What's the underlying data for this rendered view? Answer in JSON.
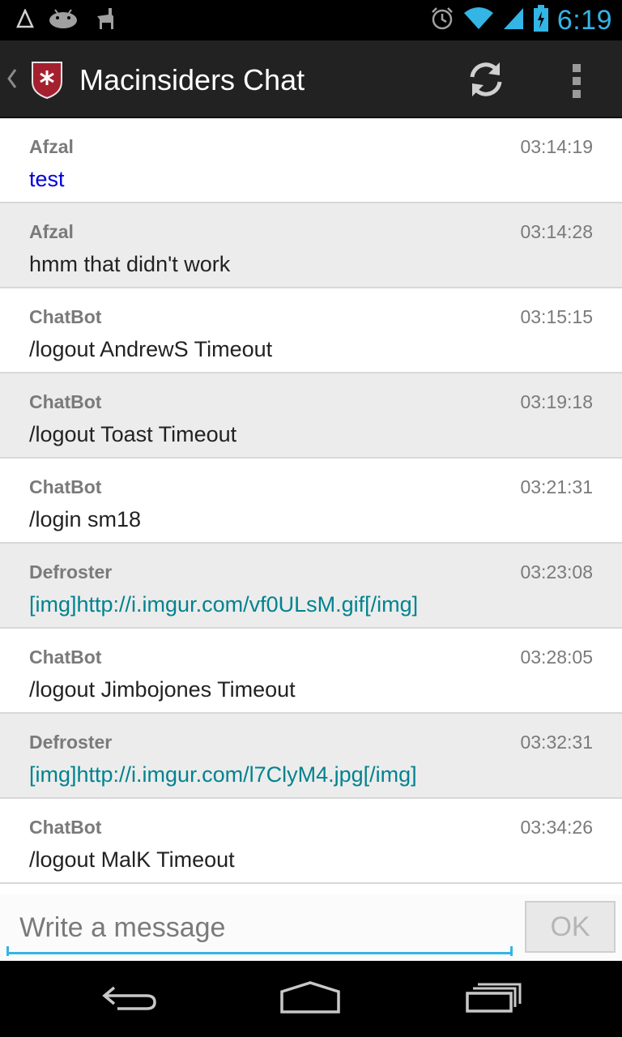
{
  "status_bar": {
    "time": "6:19",
    "left_icons": [
      "delta-icon",
      "android-icon",
      "llama-icon"
    ],
    "right_icons": [
      "alarm-icon",
      "wifi-icon",
      "signal-icon",
      "battery-charging-icon"
    ]
  },
  "action_bar": {
    "title": "Macinsiders Chat",
    "icons": [
      "up-chevron-icon",
      "app-logo-icon",
      "refresh-icon",
      "overflow-menu-icon"
    ]
  },
  "colors": {
    "accent": "#33b5e5",
    "link_blue": "#0000dd",
    "link_teal": "#00838f",
    "row_alt": "#ececec"
  },
  "messages": [
    {
      "author": "Afzal",
      "time": "03:14:19",
      "text": "test",
      "style": "blue"
    },
    {
      "author": "Afzal",
      "time": "03:14:28",
      "text": "hmm that didn't work",
      "style": "normal"
    },
    {
      "author": "ChatBot",
      "time": "03:15:15",
      "text": "/logout AndrewS Timeout",
      "style": "normal"
    },
    {
      "author": "ChatBot",
      "time": "03:19:18",
      "text": "/logout Toast Timeout",
      "style": "normal"
    },
    {
      "author": "ChatBot",
      "time": "03:21:31",
      "text": "/login sm18",
      "style": "normal"
    },
    {
      "author": "Defroster",
      "time": "03:23:08",
      "text": "[img]http://i.imgur.com/vf0ULsM.gif[/img]",
      "style": "link"
    },
    {
      "author": "ChatBot",
      "time": "03:28:05",
      "text": "/logout Jimbojones Timeout",
      "style": "normal"
    },
    {
      "author": "Defroster",
      "time": "03:32:31",
      "text": "[img]http://i.imgur.com/l7ClyM4.jpg[/img]",
      "style": "link"
    },
    {
      "author": "ChatBot",
      "time": "03:34:26",
      "text": "/logout MalK Timeout",
      "style": "normal"
    }
  ],
  "compose": {
    "placeholder": "Write a message",
    "value": "",
    "send_label": "OK"
  },
  "nav_bar": {
    "icons": [
      "back-icon",
      "home-icon",
      "recent-apps-icon"
    ]
  }
}
